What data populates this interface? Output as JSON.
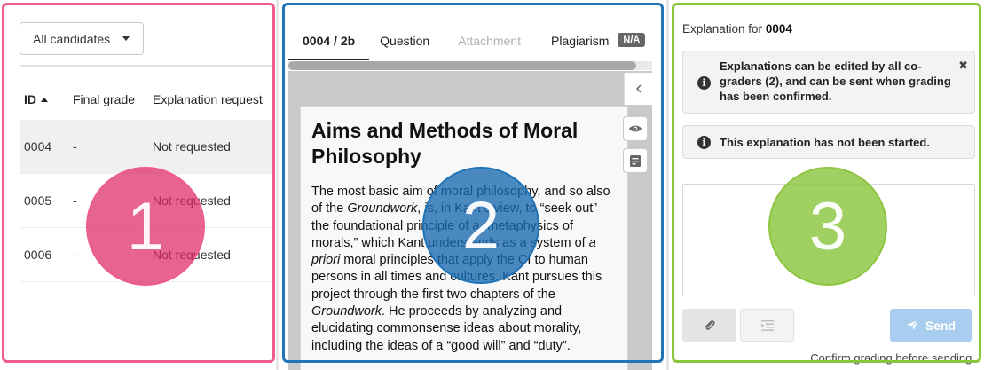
{
  "candidates_panel": {
    "filter_label": "All candidates",
    "columns": [
      "ID",
      "Final grade",
      "Explanation request"
    ],
    "rows": [
      {
        "id": "0004",
        "grade": "-",
        "request": "Not requested",
        "selected": true
      },
      {
        "id": "0005",
        "grade": "-",
        "request": "Not requested",
        "selected": false
      },
      {
        "id": "0006",
        "grade": "-",
        "request": "Not requested",
        "selected": false
      }
    ]
  },
  "submission_panel": {
    "tabs": {
      "submission": "0004 / 2b",
      "question": "Question",
      "attachment": "Attachment",
      "plagiarism": "Plagiarism",
      "plagiarism_badge": "N/A"
    },
    "document": {
      "title": "Aims and Methods of Moral Philosophy",
      "para_1": "The most basic aim of moral philosophy, and so also of the ",
      "em_1": "Groundwork",
      "para_2": ", is, in Kant’s view, to “seek out” the foundational principle of a “metaphysics of morals,” which Kant understands as a system of ",
      "em_2": "a priori",
      "para_3": " moral principles that apply the CI to human persons in all times and cultures. Kant pursues this project through the first two chapters of the ",
      "em_3": "Groundwork",
      "para_4": ". He proceeds by analyzing and elucidating commonsense ideas about morality, including the ideas of a “good will” and “duty”."
    }
  },
  "explanation_panel": {
    "title_prefix": "Explanation for",
    "candidate_id": "0004",
    "info_alert": "Explanations can be edited by all co-graders (2), and can be sent when grading has been confirmed.",
    "status_alert": "This explanation has not been started.",
    "send_label": "Send",
    "confirm_note": "Confirm grading before sending."
  },
  "overlay_markers": [
    "1",
    "2",
    "3"
  ],
  "colors": {
    "marker_1": "#ef5b8c",
    "marker_2": "#1f73b7",
    "marker_3": "#8cc63f",
    "send_disabled": "#a9cdee"
  }
}
